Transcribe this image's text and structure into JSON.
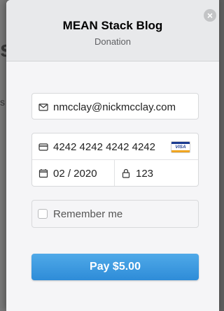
{
  "background": {
    "heading_fragment": "s",
    "text_fragment": "s"
  },
  "modal": {
    "title": "MEAN Stack Blog",
    "subtitle": "Donation",
    "close_glyph": "×"
  },
  "form": {
    "email": "nmcclay@nickmcclay.com",
    "card_number": "4242 4242 4242 4242",
    "card_brand": "VISA",
    "expiry": "02 / 2020",
    "cvc": "123",
    "remember_label": "Remember me",
    "remember_checked": false
  },
  "pay_button": {
    "label": "Pay $5.00"
  },
  "icons": {
    "email": "envelope-icon",
    "card": "credit-card-icon",
    "expiry": "calendar-icon",
    "cvc": "lock-icon",
    "brand": "visa-card-icon"
  },
  "colors": {
    "pay_button": "#3a9ae0",
    "header_bg": "#e8e9eb",
    "modal_bg": "#f5f5f7"
  }
}
